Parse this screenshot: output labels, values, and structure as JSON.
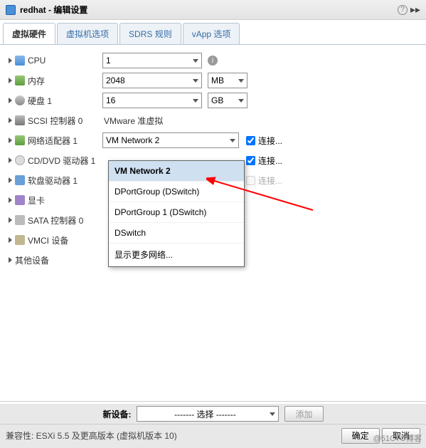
{
  "header": {
    "title": "redhat - 编辑设置"
  },
  "tabs": [
    {
      "label": "虚拟硬件",
      "active": true
    },
    {
      "label": "虚拟机选项"
    },
    {
      "label": "SDRS 规则"
    },
    {
      "label": "vApp 选项"
    }
  ],
  "rows": {
    "cpu": {
      "label": "CPU",
      "value": "1"
    },
    "mem": {
      "label": "内存",
      "value": "2048",
      "unit": "MB"
    },
    "disk": {
      "label": "硬盘 1",
      "value": "16",
      "unit": "GB"
    },
    "scsi": {
      "label": "SCSI 控制器 0",
      "value": "VMware 准虚拟"
    },
    "net": {
      "label": "网络适配器 1",
      "value": "VM Network 2",
      "conn": "连接..."
    },
    "cd": {
      "label": "CD/DVD 驱动器 1",
      "conn": "连接..."
    },
    "fd": {
      "label": "软盘驱动器 1",
      "conn": "连接..."
    },
    "vid": {
      "label": "显卡"
    },
    "sata": {
      "label": "SATA 控制器 0"
    },
    "vmci": {
      "label": "VMCI 设备"
    },
    "other": {
      "label": "其他设备"
    }
  },
  "dropdown": {
    "items": [
      "VM Network 2",
      "DPortGroup (DSwitch)",
      "DPortGroup 1 (DSwitch)",
      "DSwitch",
      "显示更多网络..."
    ],
    "selected_index": 0
  },
  "footer": {
    "newdev_label": "新设备:",
    "select_placeholder": "------- 选择 -------",
    "add": "添加",
    "compat": "兼容性: ESXi 5.5 及更高版本 (虚拟机版本 10)",
    "ok": "确定",
    "cancel": "取消"
  },
  "watermark": "@51CTO博客"
}
